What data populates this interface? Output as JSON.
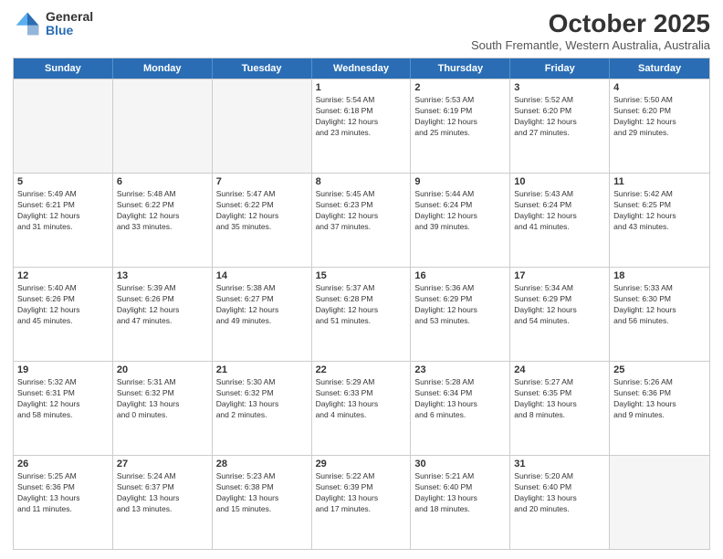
{
  "logo": {
    "general": "General",
    "blue": "Blue"
  },
  "title": "October 2025",
  "subtitle": "South Fremantle, Western Australia, Australia",
  "days_of_week": [
    "Sunday",
    "Monday",
    "Tuesday",
    "Wednesday",
    "Thursday",
    "Friday",
    "Saturday"
  ],
  "rows": [
    [
      {
        "day": "",
        "info": ""
      },
      {
        "day": "",
        "info": ""
      },
      {
        "day": "",
        "info": ""
      },
      {
        "day": "1",
        "info": "Sunrise: 5:54 AM\nSunset: 6:18 PM\nDaylight: 12 hours\nand 23 minutes."
      },
      {
        "day": "2",
        "info": "Sunrise: 5:53 AM\nSunset: 6:19 PM\nDaylight: 12 hours\nand 25 minutes."
      },
      {
        "day": "3",
        "info": "Sunrise: 5:52 AM\nSunset: 6:20 PM\nDaylight: 12 hours\nand 27 minutes."
      },
      {
        "day": "4",
        "info": "Sunrise: 5:50 AM\nSunset: 6:20 PM\nDaylight: 12 hours\nand 29 minutes."
      }
    ],
    [
      {
        "day": "5",
        "info": "Sunrise: 5:49 AM\nSunset: 6:21 PM\nDaylight: 12 hours\nand 31 minutes."
      },
      {
        "day": "6",
        "info": "Sunrise: 5:48 AM\nSunset: 6:22 PM\nDaylight: 12 hours\nand 33 minutes."
      },
      {
        "day": "7",
        "info": "Sunrise: 5:47 AM\nSunset: 6:22 PM\nDaylight: 12 hours\nand 35 minutes."
      },
      {
        "day": "8",
        "info": "Sunrise: 5:45 AM\nSunset: 6:23 PM\nDaylight: 12 hours\nand 37 minutes."
      },
      {
        "day": "9",
        "info": "Sunrise: 5:44 AM\nSunset: 6:24 PM\nDaylight: 12 hours\nand 39 minutes."
      },
      {
        "day": "10",
        "info": "Sunrise: 5:43 AM\nSunset: 6:24 PM\nDaylight: 12 hours\nand 41 minutes."
      },
      {
        "day": "11",
        "info": "Sunrise: 5:42 AM\nSunset: 6:25 PM\nDaylight: 12 hours\nand 43 minutes."
      }
    ],
    [
      {
        "day": "12",
        "info": "Sunrise: 5:40 AM\nSunset: 6:26 PM\nDaylight: 12 hours\nand 45 minutes."
      },
      {
        "day": "13",
        "info": "Sunrise: 5:39 AM\nSunset: 6:26 PM\nDaylight: 12 hours\nand 47 minutes."
      },
      {
        "day": "14",
        "info": "Sunrise: 5:38 AM\nSunset: 6:27 PM\nDaylight: 12 hours\nand 49 minutes."
      },
      {
        "day": "15",
        "info": "Sunrise: 5:37 AM\nSunset: 6:28 PM\nDaylight: 12 hours\nand 51 minutes."
      },
      {
        "day": "16",
        "info": "Sunrise: 5:36 AM\nSunset: 6:29 PM\nDaylight: 12 hours\nand 53 minutes."
      },
      {
        "day": "17",
        "info": "Sunrise: 5:34 AM\nSunset: 6:29 PM\nDaylight: 12 hours\nand 54 minutes."
      },
      {
        "day": "18",
        "info": "Sunrise: 5:33 AM\nSunset: 6:30 PM\nDaylight: 12 hours\nand 56 minutes."
      }
    ],
    [
      {
        "day": "19",
        "info": "Sunrise: 5:32 AM\nSunset: 6:31 PM\nDaylight: 12 hours\nand 58 minutes."
      },
      {
        "day": "20",
        "info": "Sunrise: 5:31 AM\nSunset: 6:32 PM\nDaylight: 13 hours\nand 0 minutes."
      },
      {
        "day": "21",
        "info": "Sunrise: 5:30 AM\nSunset: 6:32 PM\nDaylight: 13 hours\nand 2 minutes."
      },
      {
        "day": "22",
        "info": "Sunrise: 5:29 AM\nSunset: 6:33 PM\nDaylight: 13 hours\nand 4 minutes."
      },
      {
        "day": "23",
        "info": "Sunrise: 5:28 AM\nSunset: 6:34 PM\nDaylight: 13 hours\nand 6 minutes."
      },
      {
        "day": "24",
        "info": "Sunrise: 5:27 AM\nSunset: 6:35 PM\nDaylight: 13 hours\nand 8 minutes."
      },
      {
        "day": "25",
        "info": "Sunrise: 5:26 AM\nSunset: 6:36 PM\nDaylight: 13 hours\nand 9 minutes."
      }
    ],
    [
      {
        "day": "26",
        "info": "Sunrise: 5:25 AM\nSunset: 6:36 PM\nDaylight: 13 hours\nand 11 minutes."
      },
      {
        "day": "27",
        "info": "Sunrise: 5:24 AM\nSunset: 6:37 PM\nDaylight: 13 hours\nand 13 minutes."
      },
      {
        "day": "28",
        "info": "Sunrise: 5:23 AM\nSunset: 6:38 PM\nDaylight: 13 hours\nand 15 minutes."
      },
      {
        "day": "29",
        "info": "Sunrise: 5:22 AM\nSunset: 6:39 PM\nDaylight: 13 hours\nand 17 minutes."
      },
      {
        "day": "30",
        "info": "Sunrise: 5:21 AM\nSunset: 6:40 PM\nDaylight: 13 hours\nand 18 minutes."
      },
      {
        "day": "31",
        "info": "Sunrise: 5:20 AM\nSunset: 6:40 PM\nDaylight: 13 hours\nand 20 minutes."
      },
      {
        "day": "",
        "info": ""
      }
    ]
  ]
}
